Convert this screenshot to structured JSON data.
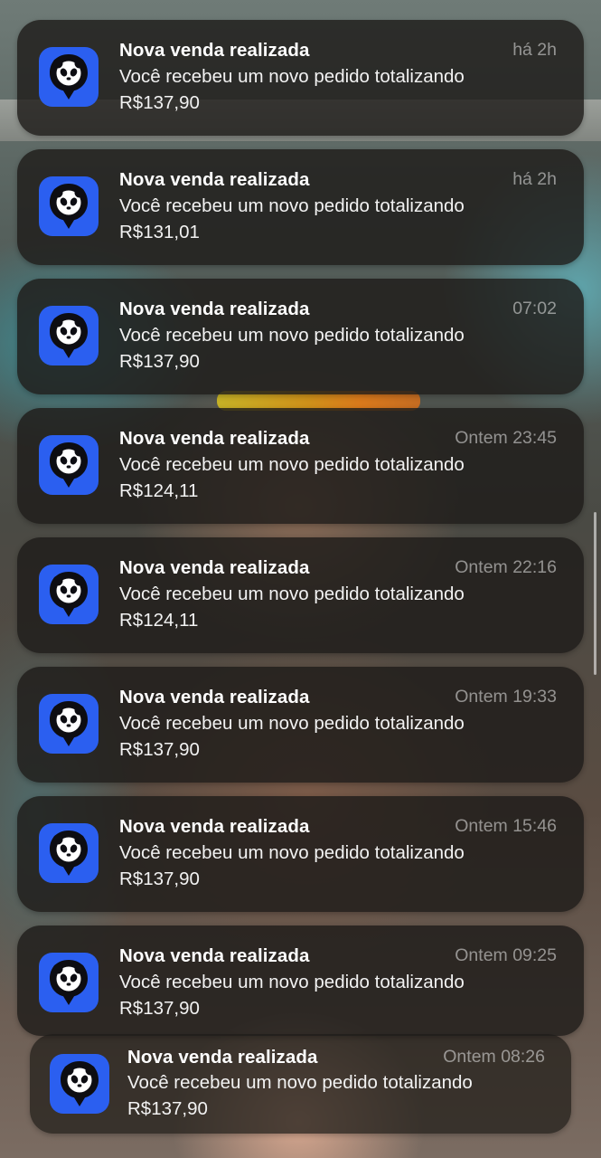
{
  "notifications": [
    {
      "title": "Nova venda realizada",
      "time": "há 2h",
      "message": "Você recebeu um novo pedido totalizando",
      "amount": "R$137,90"
    },
    {
      "title": "Nova venda realizada",
      "time": "há 2h",
      "message": "Você recebeu um novo pedido totalizando",
      "amount": "R$131,01"
    },
    {
      "title": "Nova venda realizada",
      "time": "07:02",
      "message": "Você recebeu um novo pedido totalizando",
      "amount": "R$137,90"
    },
    {
      "title": "Nova venda realizada",
      "time": "Ontem 23:45",
      "message": "Você recebeu um novo pedido totalizando",
      "amount": "R$124,11"
    },
    {
      "title": "Nova venda realizada",
      "time": "Ontem 22:16",
      "message": "Você recebeu um novo pedido totalizando",
      "amount": "R$124,11"
    },
    {
      "title": "Nova venda realizada",
      "time": "Ontem 19:33",
      "message": "Você recebeu um novo pedido totalizando",
      "amount": "R$137,90"
    },
    {
      "title": "Nova venda realizada",
      "time": "Ontem 15:46",
      "message": "Você recebeu um novo pedido totalizando",
      "amount": "R$137,90"
    },
    {
      "title": "Nova venda realizada",
      "time": "Ontem 09:25",
      "message": "Você recebeu um novo pedido totalizando",
      "amount": "R$137,90"
    },
    {
      "title": "Nova venda realizada",
      "time": "Ontem 08:26",
      "message": "Você recebeu um novo pedido totalizando",
      "amount": "R$137,90"
    }
  ],
  "app_icon": {
    "name": "panda-app-icon",
    "background": "#2b5ff0"
  }
}
